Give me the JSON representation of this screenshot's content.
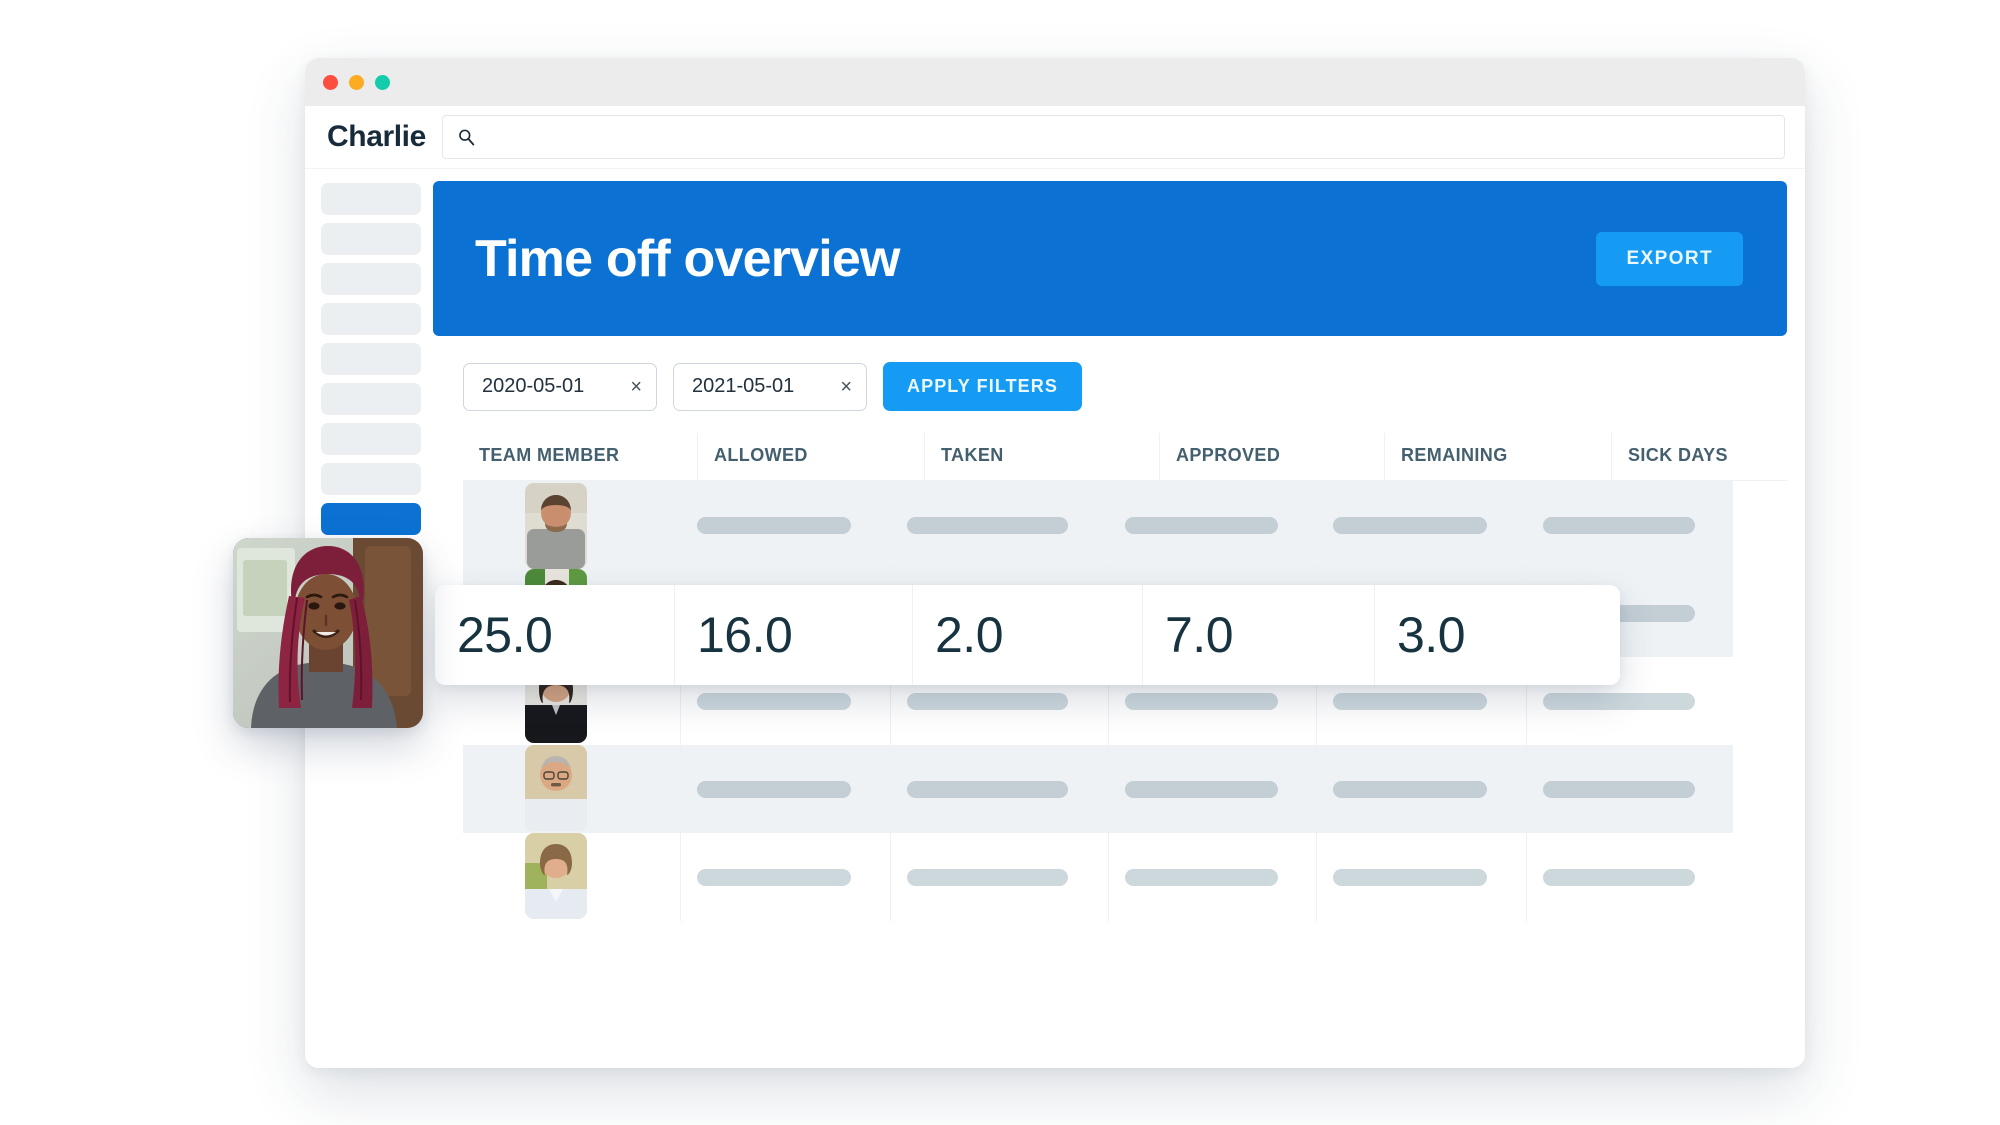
{
  "window": {
    "traffic_lights": [
      {
        "name": "close",
        "color": "#fc4f40"
      },
      {
        "name": "minimize",
        "color": "#fcac22"
      },
      {
        "name": "maximize",
        "color": "#13ccab"
      }
    ]
  },
  "topbar": {
    "logo": "Charlie",
    "search": {
      "icon": "search-icon",
      "value": "",
      "placeholder": ""
    }
  },
  "sidebar": {
    "items": [
      {
        "label": "",
        "active": false
      },
      {
        "label": "",
        "active": false
      },
      {
        "label": "",
        "active": false
      },
      {
        "label": "",
        "active": false
      },
      {
        "label": "",
        "active": false
      },
      {
        "label": "",
        "active": false
      },
      {
        "label": "",
        "active": false
      },
      {
        "label": "",
        "active": false
      },
      {
        "label": "",
        "active": true
      }
    ],
    "active_color": "#0b72d4",
    "item_color": "#eceff2"
  },
  "hero": {
    "title": "Time off overview",
    "background": "#0b72d4",
    "export_label": "EXPORT",
    "export_color": "#159bf3"
  },
  "filters": {
    "start_date": "2020-05-01",
    "end_date": "2021-05-01",
    "clear_icon": "×",
    "apply_label": "APPLY FILTERS",
    "apply_color": "#159bf3"
  },
  "table": {
    "columns": [
      "TEAM MEMBER",
      "ALLOWED",
      "TAKEN",
      "APPROVED",
      "REMAINING",
      "SICK DAYS"
    ],
    "rows": [
      {
        "avatar": "avatar-man-grey-tshirt",
        "placeholder": true,
        "shaded": true
      },
      {
        "avatar": "avatar-man-plants",
        "placeholder": true,
        "shaded": true
      },
      {
        "avatar": "avatar-woman-dark-top",
        "placeholder": true,
        "shaded": false
      },
      {
        "avatar": "avatar-man-glasses-moustache",
        "placeholder": true,
        "shaded": true
      },
      {
        "avatar": "avatar-woman-light-blouse",
        "placeholder": true,
        "shaded": false
      }
    ]
  },
  "highlight_row": {
    "values": [
      "25.0",
      "16.0",
      "2.0",
      "7.0",
      "3.0"
    ]
  },
  "foreground_person": {
    "name": "avatar-woman-red-braids"
  }
}
